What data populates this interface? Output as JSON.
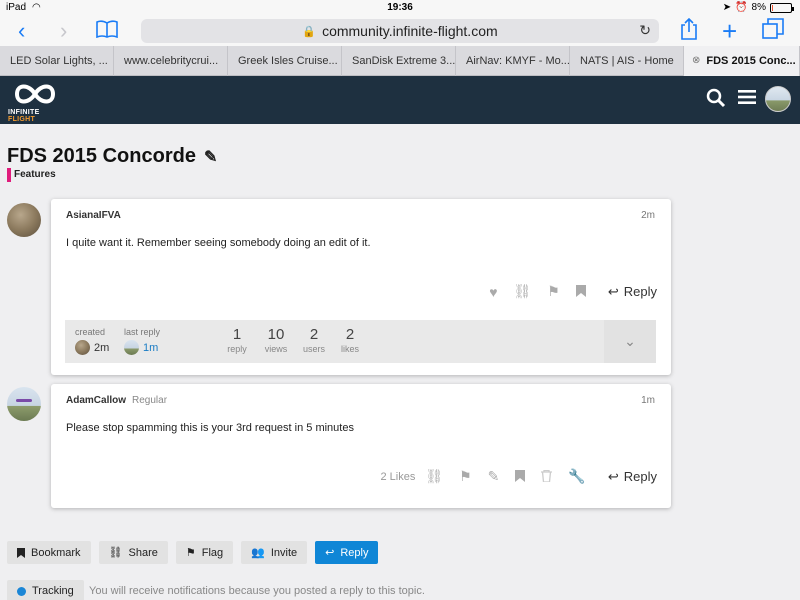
{
  "statusbar": {
    "device": "iPad",
    "time": "19:36",
    "battery": "8%",
    "battery_level": 0.08
  },
  "browser": {
    "url": "community.infinite-flight.com",
    "tabs": [
      {
        "label": "LED Solar Lights, ..."
      },
      {
        "label": "www.celebritycrui..."
      },
      {
        "label": "Greek Isles Cruise..."
      },
      {
        "label": "SanDisk Extreme 3..."
      },
      {
        "label": "AirNav: KMYF - Mo..."
      },
      {
        "label": "NATS | AIS - Home"
      },
      {
        "label": "FDS 2015 Conc..."
      }
    ]
  },
  "site": {
    "logo_text_main": "INFINITE ",
    "logo_text_accent": "FLIGHT",
    "colors": {
      "header": "#1e3040",
      "accent": "#f29a2e",
      "category": "#e01c7c",
      "primary": "#0f86d6"
    }
  },
  "topic": {
    "title": "FDS 2015 Concorde",
    "category": "Features"
  },
  "posts": [
    {
      "author": "AsianaIFVA",
      "user_title": "",
      "age": "2m",
      "body": "I quite want it. Remember seeing somebody doing an edit of it.",
      "reply_label": "Reply"
    },
    {
      "author": "AdamCallow",
      "user_title": "Regular",
      "age": "1m",
      "body": "Please stop spamming this is your 3rd request in 5 minutes",
      "likes": "2 Likes",
      "reply_label": "Reply"
    }
  ],
  "topic_map": {
    "created_label": "created",
    "created_value": "2m",
    "last_reply_label": "last reply",
    "last_reply_value": "1m",
    "stats": [
      {
        "num": "1",
        "label": "reply"
      },
      {
        "num": "10",
        "label": "views"
      },
      {
        "num": "2",
        "label": "users"
      },
      {
        "num": "2",
        "label": "likes"
      }
    ]
  },
  "footer": {
    "bookmark": "Bookmark",
    "share": "Share",
    "flag": "Flag",
    "invite": "Invite",
    "reply": "Reply",
    "tracking": "Tracking",
    "tracking_desc": "You will receive notifications because you posted a reply to this topic."
  }
}
